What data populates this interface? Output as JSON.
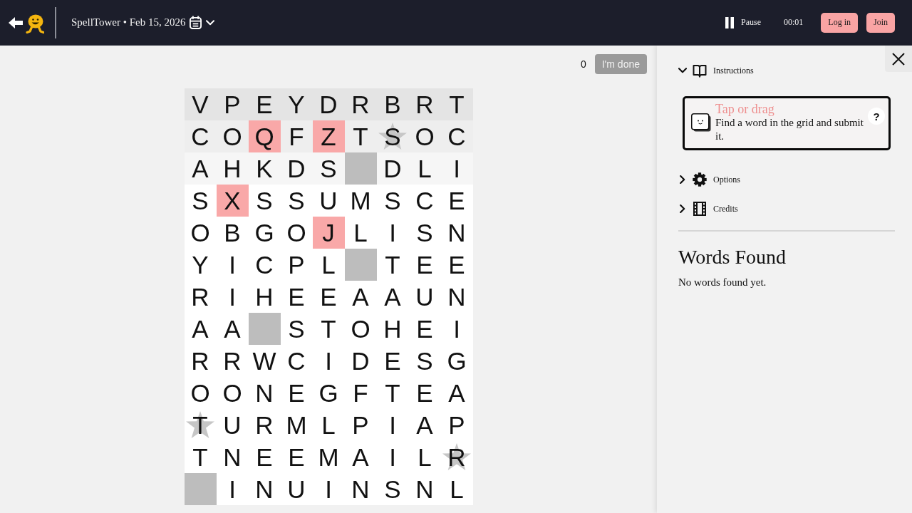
{
  "header": {
    "title": "SpellTower • Feb 15, 2026",
    "pause": {
      "label": "Pause"
    },
    "timer": "00:01",
    "buttons": [
      {
        "label": "Log in"
      },
      {
        "label": "Join"
      }
    ]
  },
  "game": {
    "score": "0",
    "done_button": {
      "label": "I'm done",
      "disabled": true
    },
    "grid": {
      "rows": [
        {
          "color": "#e4e4e4",
          "cells": [
            {
              "kind": "letter",
              "letter": "V",
              "rare": false,
              "star": false
            },
            {
              "kind": "letter",
              "letter": "P",
              "rare": false,
              "star": false
            },
            {
              "kind": "letter",
              "letter": "E",
              "rare": false,
              "star": false
            },
            {
              "kind": "letter",
              "letter": "Y",
              "rare": false,
              "star": false
            },
            {
              "kind": "letter",
              "letter": "D",
              "rare": false,
              "star": false
            },
            {
              "kind": "letter",
              "letter": "R",
              "rare": false,
              "star": false
            },
            {
              "kind": "letter",
              "letter": "B",
              "rare": false,
              "star": false
            },
            {
              "kind": "letter",
              "letter": "R",
              "rare": false,
              "star": false
            },
            {
              "kind": "letter",
              "letter": "T",
              "rare": false,
              "star": false
            }
          ]
        },
        {
          "color": "#eeeeee",
          "cells": [
            {
              "kind": "letter",
              "letter": "C",
              "rare": false,
              "star": false
            },
            {
              "kind": "letter",
              "letter": "O",
              "rare": false,
              "star": false
            },
            {
              "kind": "letter",
              "letter": "Q",
              "rare": true,
              "star": false
            },
            {
              "kind": "letter",
              "letter": "F",
              "rare": false,
              "star": false
            },
            {
              "kind": "letter",
              "letter": "Z",
              "rare": true,
              "star": false
            },
            {
              "kind": "letter",
              "letter": "T",
              "rare": false,
              "star": false
            },
            {
              "kind": "letter",
              "letter": "S",
              "rare": false,
              "star": true
            },
            {
              "kind": "letter",
              "letter": "O",
              "rare": false,
              "star": false
            },
            {
              "kind": "letter",
              "letter": "C",
              "rare": false,
              "star": false
            }
          ]
        },
        {
          "color": "#f6f6f6",
          "cells": [
            {
              "kind": "letter",
              "letter": "A",
              "rare": false,
              "star": false
            },
            {
              "kind": "letter",
              "letter": "H",
              "rare": false,
              "star": false
            },
            {
              "kind": "letter",
              "letter": "K",
              "rare": false,
              "star": false
            },
            {
              "kind": "letter",
              "letter": "D",
              "rare": false,
              "star": false
            },
            {
              "kind": "letter",
              "letter": "S",
              "rare": false,
              "star": false
            },
            {
              "kind": "blank",
              "rare": false,
              "star": false
            },
            {
              "kind": "letter",
              "letter": "D",
              "rare": false,
              "star": false
            },
            {
              "kind": "letter",
              "letter": "L",
              "rare": false,
              "star": false
            },
            {
              "kind": "letter",
              "letter": "I",
              "rare": false,
              "star": false
            }
          ]
        },
        {
          "color": "#ffffff",
          "cells": [
            {
              "kind": "letter",
              "letter": "S",
              "rare": false,
              "star": false
            },
            {
              "kind": "letter",
              "letter": "X",
              "rare": true,
              "star": false
            },
            {
              "kind": "letter",
              "letter": "S",
              "rare": false,
              "star": false
            },
            {
              "kind": "letter",
              "letter": "S",
              "rare": false,
              "star": false
            },
            {
              "kind": "letter",
              "letter": "U",
              "rare": false,
              "star": false
            },
            {
              "kind": "letter",
              "letter": "M",
              "rare": false,
              "star": false
            },
            {
              "kind": "letter",
              "letter": "S",
              "rare": false,
              "star": false
            },
            {
              "kind": "letter",
              "letter": "C",
              "rare": false,
              "star": false
            },
            {
              "kind": "letter",
              "letter": "E",
              "rare": false,
              "star": false
            }
          ]
        },
        {
          "color": "#ffffff",
          "cells": [
            {
              "kind": "letter",
              "letter": "O",
              "rare": false,
              "star": false
            },
            {
              "kind": "letter",
              "letter": "B",
              "rare": false,
              "star": false
            },
            {
              "kind": "letter",
              "letter": "G",
              "rare": false,
              "star": false
            },
            {
              "kind": "letter",
              "letter": "O",
              "rare": false,
              "star": false
            },
            {
              "kind": "letter",
              "letter": "J",
              "rare": true,
              "star": false
            },
            {
              "kind": "letter",
              "letter": "L",
              "rare": false,
              "star": false
            },
            {
              "kind": "letter",
              "letter": "I",
              "rare": false,
              "star": false
            },
            {
              "kind": "letter",
              "letter": "S",
              "rare": false,
              "star": false
            },
            {
              "kind": "letter",
              "letter": "N",
              "rare": false,
              "star": false
            }
          ]
        },
        {
          "color": "#ffffff",
          "cells": [
            {
              "kind": "letter",
              "letter": "Y",
              "rare": false,
              "star": false
            },
            {
              "kind": "letter",
              "letter": "I",
              "rare": false,
              "star": false
            },
            {
              "kind": "letter",
              "letter": "C",
              "rare": false,
              "star": false
            },
            {
              "kind": "letter",
              "letter": "P",
              "rare": false,
              "star": false
            },
            {
              "kind": "letter",
              "letter": "L",
              "rare": false,
              "star": false
            },
            {
              "kind": "blank",
              "rare": false,
              "star": false
            },
            {
              "kind": "letter",
              "letter": "T",
              "rare": false,
              "star": false
            },
            {
              "kind": "letter",
              "letter": "E",
              "rare": false,
              "star": false
            },
            {
              "kind": "letter",
              "letter": "E",
              "rare": false,
              "star": false
            }
          ]
        },
        {
          "color": "#ffffff",
          "cells": [
            {
              "kind": "letter",
              "letter": "R",
              "rare": false,
              "star": false
            },
            {
              "kind": "letter",
              "letter": "I",
              "rare": false,
              "star": false
            },
            {
              "kind": "letter",
              "letter": "H",
              "rare": false,
              "star": false
            },
            {
              "kind": "letter",
              "letter": "E",
              "rare": false,
              "star": false
            },
            {
              "kind": "letter",
              "letter": "E",
              "rare": false,
              "star": false
            },
            {
              "kind": "letter",
              "letter": "A",
              "rare": false,
              "star": false
            },
            {
              "kind": "letter",
              "letter": "A",
              "rare": false,
              "star": false
            },
            {
              "kind": "letter",
              "letter": "U",
              "rare": false,
              "star": false
            },
            {
              "kind": "letter",
              "letter": "N",
              "rare": false,
              "star": false
            }
          ]
        },
        {
          "color": "#ffffff",
          "cells": [
            {
              "kind": "letter",
              "letter": "A",
              "rare": false,
              "star": false
            },
            {
              "kind": "letter",
              "letter": "A",
              "rare": false,
              "star": false
            },
            {
              "kind": "blank",
              "rare": false,
              "star": false
            },
            {
              "kind": "letter",
              "letter": "S",
              "rare": false,
              "star": false
            },
            {
              "kind": "letter",
              "letter": "T",
              "rare": false,
              "star": false
            },
            {
              "kind": "letter",
              "letter": "O",
              "rare": false,
              "star": false
            },
            {
              "kind": "letter",
              "letter": "H",
              "rare": false,
              "star": false
            },
            {
              "kind": "letter",
              "letter": "E",
              "rare": false,
              "star": false
            },
            {
              "kind": "letter",
              "letter": "I",
              "rare": false,
              "star": false
            }
          ]
        },
        {
          "color": "#ffffff",
          "cells": [
            {
              "kind": "letter",
              "letter": "R",
              "rare": false,
              "star": false
            },
            {
              "kind": "letter",
              "letter": "R",
              "rare": false,
              "star": false
            },
            {
              "kind": "letter",
              "letter": "W",
              "rare": false,
              "star": false
            },
            {
              "kind": "letter",
              "letter": "C",
              "rare": false,
              "star": false
            },
            {
              "kind": "letter",
              "letter": "I",
              "rare": false,
              "star": false
            },
            {
              "kind": "letter",
              "letter": "D",
              "rare": false,
              "star": false
            },
            {
              "kind": "letter",
              "letter": "E",
              "rare": false,
              "star": false
            },
            {
              "kind": "letter",
              "letter": "S",
              "rare": false,
              "star": false
            },
            {
              "kind": "letter",
              "letter": "G",
              "rare": false,
              "star": false
            }
          ]
        },
        {
          "color": "#ffffff",
          "cells": [
            {
              "kind": "letter",
              "letter": "O",
              "rare": false,
              "star": false
            },
            {
              "kind": "letter",
              "letter": "O",
              "rare": false,
              "star": false
            },
            {
              "kind": "letter",
              "letter": "N",
              "rare": false,
              "star": false
            },
            {
              "kind": "letter",
              "letter": "E",
              "rare": false,
              "star": false
            },
            {
              "kind": "letter",
              "letter": "G",
              "rare": false,
              "star": false
            },
            {
              "kind": "letter",
              "letter": "F",
              "rare": false,
              "star": false
            },
            {
              "kind": "letter",
              "letter": "T",
              "rare": false,
              "star": false
            },
            {
              "kind": "letter",
              "letter": "E",
              "rare": false,
              "star": false
            },
            {
              "kind": "letter",
              "letter": "A",
              "rare": false,
              "star": false
            }
          ]
        },
        {
          "color": "#ffffff",
          "cells": [
            {
              "kind": "letter",
              "letter": "T",
              "rare": false,
              "star": true
            },
            {
              "kind": "letter",
              "letter": "U",
              "rare": false,
              "star": false
            },
            {
              "kind": "letter",
              "letter": "R",
              "rare": false,
              "star": false
            },
            {
              "kind": "letter",
              "letter": "M",
              "rare": false,
              "star": false
            },
            {
              "kind": "letter",
              "letter": "L",
              "rare": false,
              "star": false
            },
            {
              "kind": "letter",
              "letter": "P",
              "rare": false,
              "star": false
            },
            {
              "kind": "letter",
              "letter": "I",
              "rare": false,
              "star": false
            },
            {
              "kind": "letter",
              "letter": "A",
              "rare": false,
              "star": false
            },
            {
              "kind": "letter",
              "letter": "P",
              "rare": false,
              "star": false
            }
          ]
        },
        {
          "color": "#ffffff",
          "cells": [
            {
              "kind": "letter",
              "letter": "T",
              "rare": false,
              "star": false
            },
            {
              "kind": "letter",
              "letter": "N",
              "rare": false,
              "star": false
            },
            {
              "kind": "letter",
              "letter": "E",
              "rare": false,
              "star": false
            },
            {
              "kind": "letter",
              "letter": "E",
              "rare": false,
              "star": false
            },
            {
              "kind": "letter",
              "letter": "M",
              "rare": false,
              "star": false
            },
            {
              "kind": "letter",
              "letter": "A",
              "rare": false,
              "star": false
            },
            {
              "kind": "letter",
              "letter": "I",
              "rare": false,
              "star": false
            },
            {
              "kind": "letter",
              "letter": "L",
              "rare": false,
              "star": false
            },
            {
              "kind": "letter",
              "letter": "R",
              "rare": false,
              "star": true
            }
          ]
        },
        {
          "color": "#ffffff",
          "cells": [
            {
              "kind": "blank",
              "rare": false,
              "star": false
            },
            {
              "kind": "letter",
              "letter": "I",
              "rare": false,
              "star": false
            },
            {
              "kind": "letter",
              "letter": "N",
              "rare": false,
              "star": false
            },
            {
              "kind": "letter",
              "letter": "U",
              "rare": false,
              "star": false
            },
            {
              "kind": "letter",
              "letter": "I",
              "rare": false,
              "star": false
            },
            {
              "kind": "letter",
              "letter": "N",
              "rare": false,
              "star": false
            },
            {
              "kind": "letter",
              "letter": "S",
              "rare": false,
              "star": false
            },
            {
              "kind": "letter",
              "letter": "N",
              "rare": false,
              "star": false
            },
            {
              "kind": "letter",
              "letter": "L",
              "rare": false,
              "star": false
            }
          ]
        }
      ]
    }
  },
  "panel": {
    "sections": [
      {
        "kind": "instructions",
        "label": "Instructions",
        "expanded": true,
        "card": {
          "title": "Tap or drag",
          "text": "Find a word in the grid and submit it.",
          "help": "?"
        }
      },
      {
        "kind": "options",
        "label": "Options",
        "expanded": false
      },
      {
        "kind": "credits",
        "label": "Credits",
        "expanded": false
      }
    ],
    "words_found": {
      "title": "Words Found",
      "empty_text": "No words found yet."
    }
  }
}
